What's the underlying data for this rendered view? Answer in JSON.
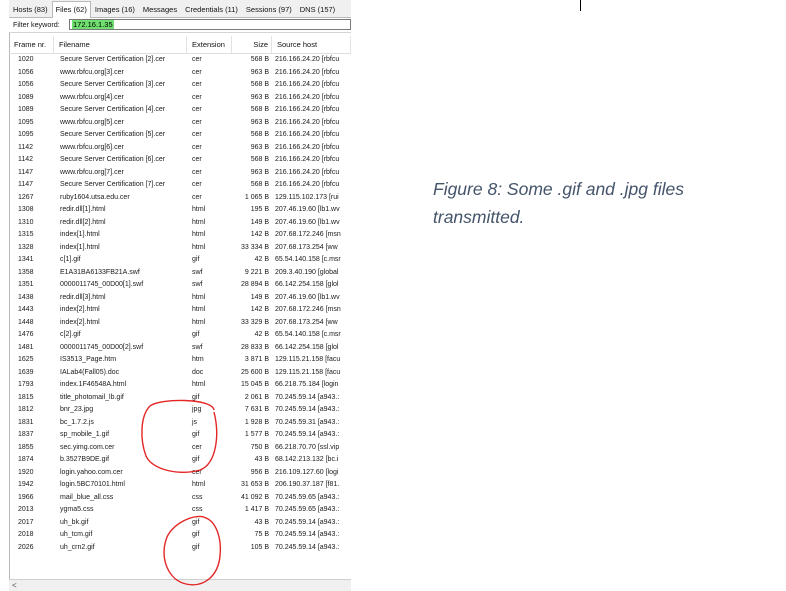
{
  "tabs": [
    {
      "label": "Hosts (83)",
      "active": false
    },
    {
      "label": "Files (62)",
      "active": true
    },
    {
      "label": "Images (16)",
      "active": false
    },
    {
      "label": "Messages",
      "active": false
    },
    {
      "label": "Credentials (11)",
      "active": false
    },
    {
      "label": "Sessions (97)",
      "active": false
    },
    {
      "label": "DNS (157)",
      "active": false
    }
  ],
  "filter": {
    "label": "Filter keyword:",
    "value": "172.16.1.35"
  },
  "columns": [
    "Frame nr.",
    "Filename",
    "Extension",
    "Size",
    "Source host"
  ],
  "rows": [
    [
      "1020",
      "Secure Server Certification [2].cer",
      "cer",
      "568 B",
      "216.166.24.20 [rbfcu"
    ],
    [
      "1056",
      "www.rbfcu.org[3].cer",
      "cer",
      "963 B",
      "216.166.24.20 [rbfcu"
    ],
    [
      "1056",
      "Secure Server Certification [3].cer",
      "cer",
      "568 B",
      "216.166.24.20 [rbfcu"
    ],
    [
      "1089",
      "www.rbfcu.org[4].cer",
      "cer",
      "963 B",
      "216.166.24.20 [rbfcu"
    ],
    [
      "1089",
      "Secure Server Certification [4].cer",
      "cer",
      "568 B",
      "216.166.24.20 [rbfcu"
    ],
    [
      "1095",
      "www.rbfcu.org[5].cer",
      "cer",
      "963 B",
      "216.166.24.20 [rbfcu"
    ],
    [
      "1095",
      "Secure Server Certification [5].cer",
      "cer",
      "568 B",
      "216.166.24.20 [rbfcu"
    ],
    [
      "1142",
      "www.rbfcu.org[6].cer",
      "cer",
      "963 B",
      "216.166.24.20 [rbfcu"
    ],
    [
      "1142",
      "Secure Server Certification [6].cer",
      "cer",
      "568 B",
      "216.166.24.20 [rbfcu"
    ],
    [
      "1147",
      "www.rbfcu.org[7].cer",
      "cer",
      "963 B",
      "216.166.24.20 [rbfcu"
    ],
    [
      "1147",
      "Secure Server Certification [7].cer",
      "cer",
      "568 B",
      "216.166.24.20 [rbfcu"
    ],
    [
      "1267",
      "ruby1604.utsa.edu.cer",
      "cer",
      "1 065 B",
      "129.115.102.173 [rui"
    ],
    [
      "1308",
      "redir.dll[1].html",
      "html",
      "195 B",
      "207.46.19.60 [lb1.wv"
    ],
    [
      "1310",
      "redir.dll[2].html",
      "html",
      "149 B",
      "207.46.19.60 [lb1.wv"
    ],
    [
      "1315",
      "index[1].html",
      "html",
      "142 B",
      "207.68.172.246 [msn"
    ],
    [
      "1328",
      "index[1].html",
      "html",
      "33 334 B",
      "207.68.173.254 [ww"
    ],
    [
      "1341",
      "c[1].gif",
      "gif",
      "42 B",
      "65.54.140.158 [c.msr"
    ],
    [
      "1358",
      "E1A31BA6133FB21A.swf",
      "swf",
      "9 221 B",
      "209.3.40.190 [global"
    ],
    [
      "1351",
      "0000011745_00D00[1].swf",
      "swf",
      "28 894 B",
      "66.142.254.158 [glol"
    ],
    [
      "1438",
      "redir.dll[3].html",
      "html",
      "149 B",
      "207.46.19.60 [lb1.wv"
    ],
    [
      "1443",
      "index[2].html",
      "html",
      "142 B",
      "207.68.172.246 [msn"
    ],
    [
      "1448",
      "index[2].html",
      "html",
      "33 329 B",
      "207.68.173.254 [ww"
    ],
    [
      "1476",
      "c[2].gif",
      "gif",
      "42 B",
      "65.54.140.158 [c.msr"
    ],
    [
      "1481",
      "0000011745_00D00[2].swf",
      "swf",
      "28 833 B",
      "66.142.254.158 [glol"
    ],
    [
      "1625",
      "IS3513_Page.htm",
      "htm",
      "3 871 B",
      "129.115.21.158 [facu"
    ],
    [
      "1639",
      "IALab4(Fall05).doc",
      "doc",
      "25 600 B",
      "129.115.21.158 [facu"
    ],
    [
      "1793",
      "index.1F46548A.html",
      "html",
      "15 045 B",
      "66.218.75.184 [login"
    ],
    [
      "1815",
      "title_photomail_lb.gif",
      "gif",
      "2 061 B",
      "70.245.59.14 [a943.:"
    ],
    [
      "1812",
      "bnr_23.jpg",
      "jpg",
      "7 631 B",
      "70.245.59.14 [a943.:"
    ],
    [
      "1831",
      "bc_1.7.2.js",
      "js",
      "1 928 B",
      "70.245.59.31 [a943.:"
    ],
    [
      "1837",
      "sp_mobile_1.gif",
      "gif",
      "1 577 B",
      "70.245.59.14 [a943.:"
    ],
    [
      "1855",
      "sec.yimg.com.cer",
      "cer",
      "750 B",
      "66.218.70.70 [ssl.vip"
    ],
    [
      "1874",
      "b.3527B9DE.gif",
      "gif",
      "43 B",
      "68.142.213.132 [bc.i"
    ],
    [
      "1920",
      "login.yahoo.com.cer",
      "cer",
      "956 B",
      "216.109.127.60 [logi"
    ],
    [
      "1942",
      "login.5BC70101.html",
      "html",
      "31 653 B",
      "206.190.37.187 [f81."
    ],
    [
      "1966",
      "mail_blue_all.css",
      "css",
      "41 092 B",
      "70.245.59.65 [a943.:"
    ],
    [
      "2013",
      "ygma5.css",
      "css",
      "1 417 B",
      "70.245.59.65 [a943.:"
    ],
    [
      "2017",
      "uh_bk.gif",
      "gif",
      "43 B",
      "70.245.59.14 [a943.:"
    ],
    [
      "2018",
      "uh_tcm.gif",
      "gif",
      "75 B",
      "70.245.59.14 [a943.:"
    ],
    [
      "2026",
      "uh_crn2.gif",
      "gif",
      "105 B",
      "70.245.59.14 [a943.:"
    ]
  ],
  "scroll_left_glyph": "<",
  "caption": {
    "line1": "Figure 8: Some .gif and .jpg files",
    "line2": "transmitted."
  },
  "colors": {
    "filter_highlight": "#6fe06f",
    "annotation": "#e32626",
    "caption": "#44546a"
  }
}
